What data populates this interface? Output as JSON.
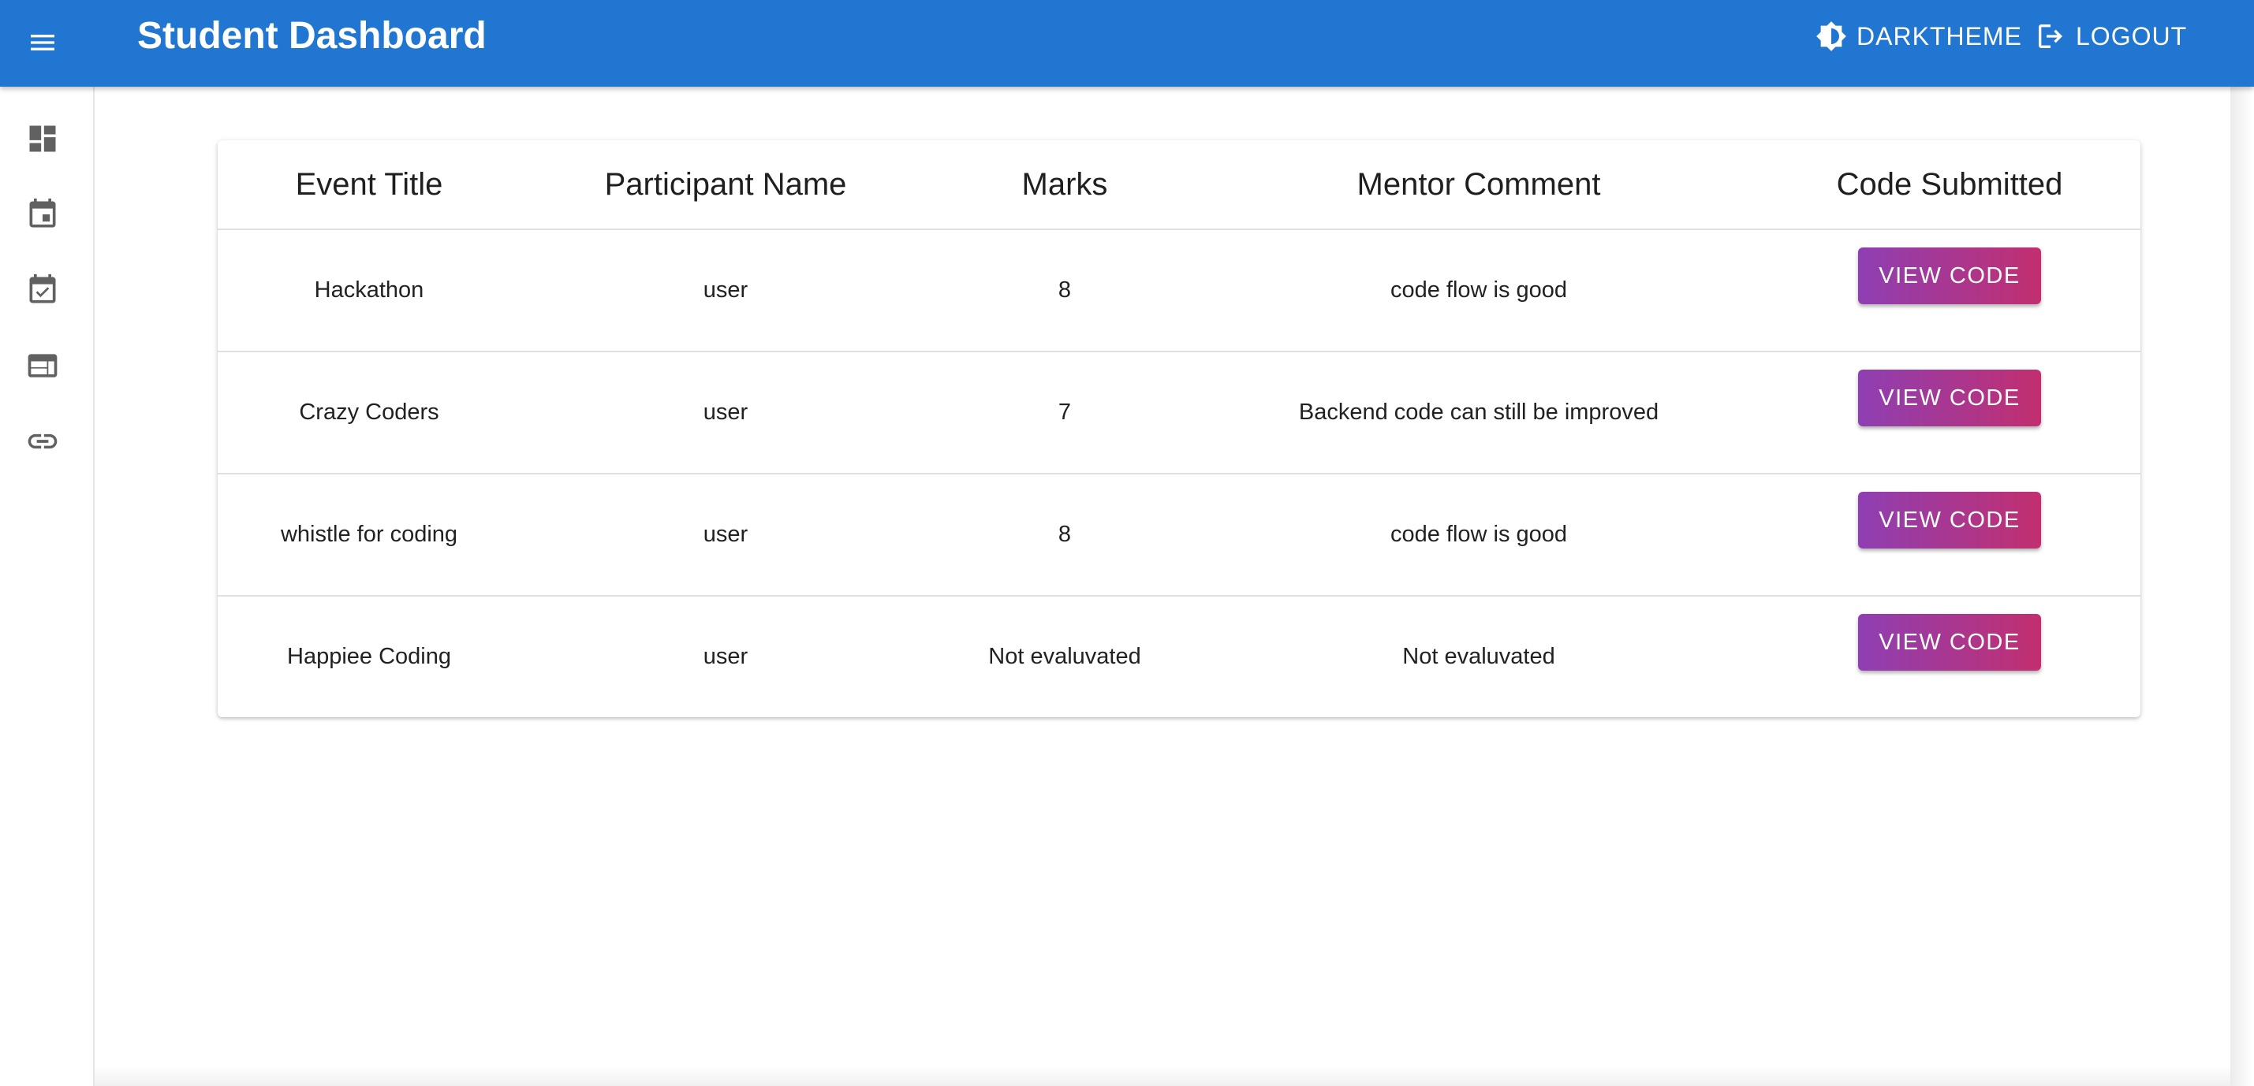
{
  "appbar": {
    "title": "Student Dashboard",
    "dark_theme_label": "DARKTHEME",
    "logout_label": "LOGOUT",
    "background_color": "#2176d2"
  },
  "sidebar": {
    "items": [
      {
        "icon": "dashboard-icon"
      },
      {
        "icon": "calendar-event-icon"
      },
      {
        "icon": "calendar-check-icon"
      },
      {
        "icon": "web-window-icon"
      },
      {
        "icon": "link-icon"
      }
    ]
  },
  "table": {
    "headers": [
      "Event Title",
      "Participant Name",
      "Marks",
      "Mentor Comment",
      "Code Submitted"
    ],
    "rows": [
      {
        "event": "Hackathon",
        "participant": "user",
        "marks": "8",
        "comment": "code flow is good",
        "action": "VIEW CODE"
      },
      {
        "event": "Crazy Coders",
        "participant": "user",
        "marks": "7",
        "comment": "Backend code can still be improved",
        "action": "VIEW CODE"
      },
      {
        "event": "whistle for coding",
        "participant": "user",
        "marks": "8",
        "comment": "code flow is good",
        "action": "VIEW CODE"
      },
      {
        "event": "Happiee Coding",
        "participant": "user",
        "marks": "Not evaluvated",
        "comment": "Not evaluvated",
        "action": "VIEW CODE"
      }
    ]
  },
  "colors": {
    "button_gradient_start": "#8e3fb3",
    "button_gradient_end": "#c22f6f"
  }
}
